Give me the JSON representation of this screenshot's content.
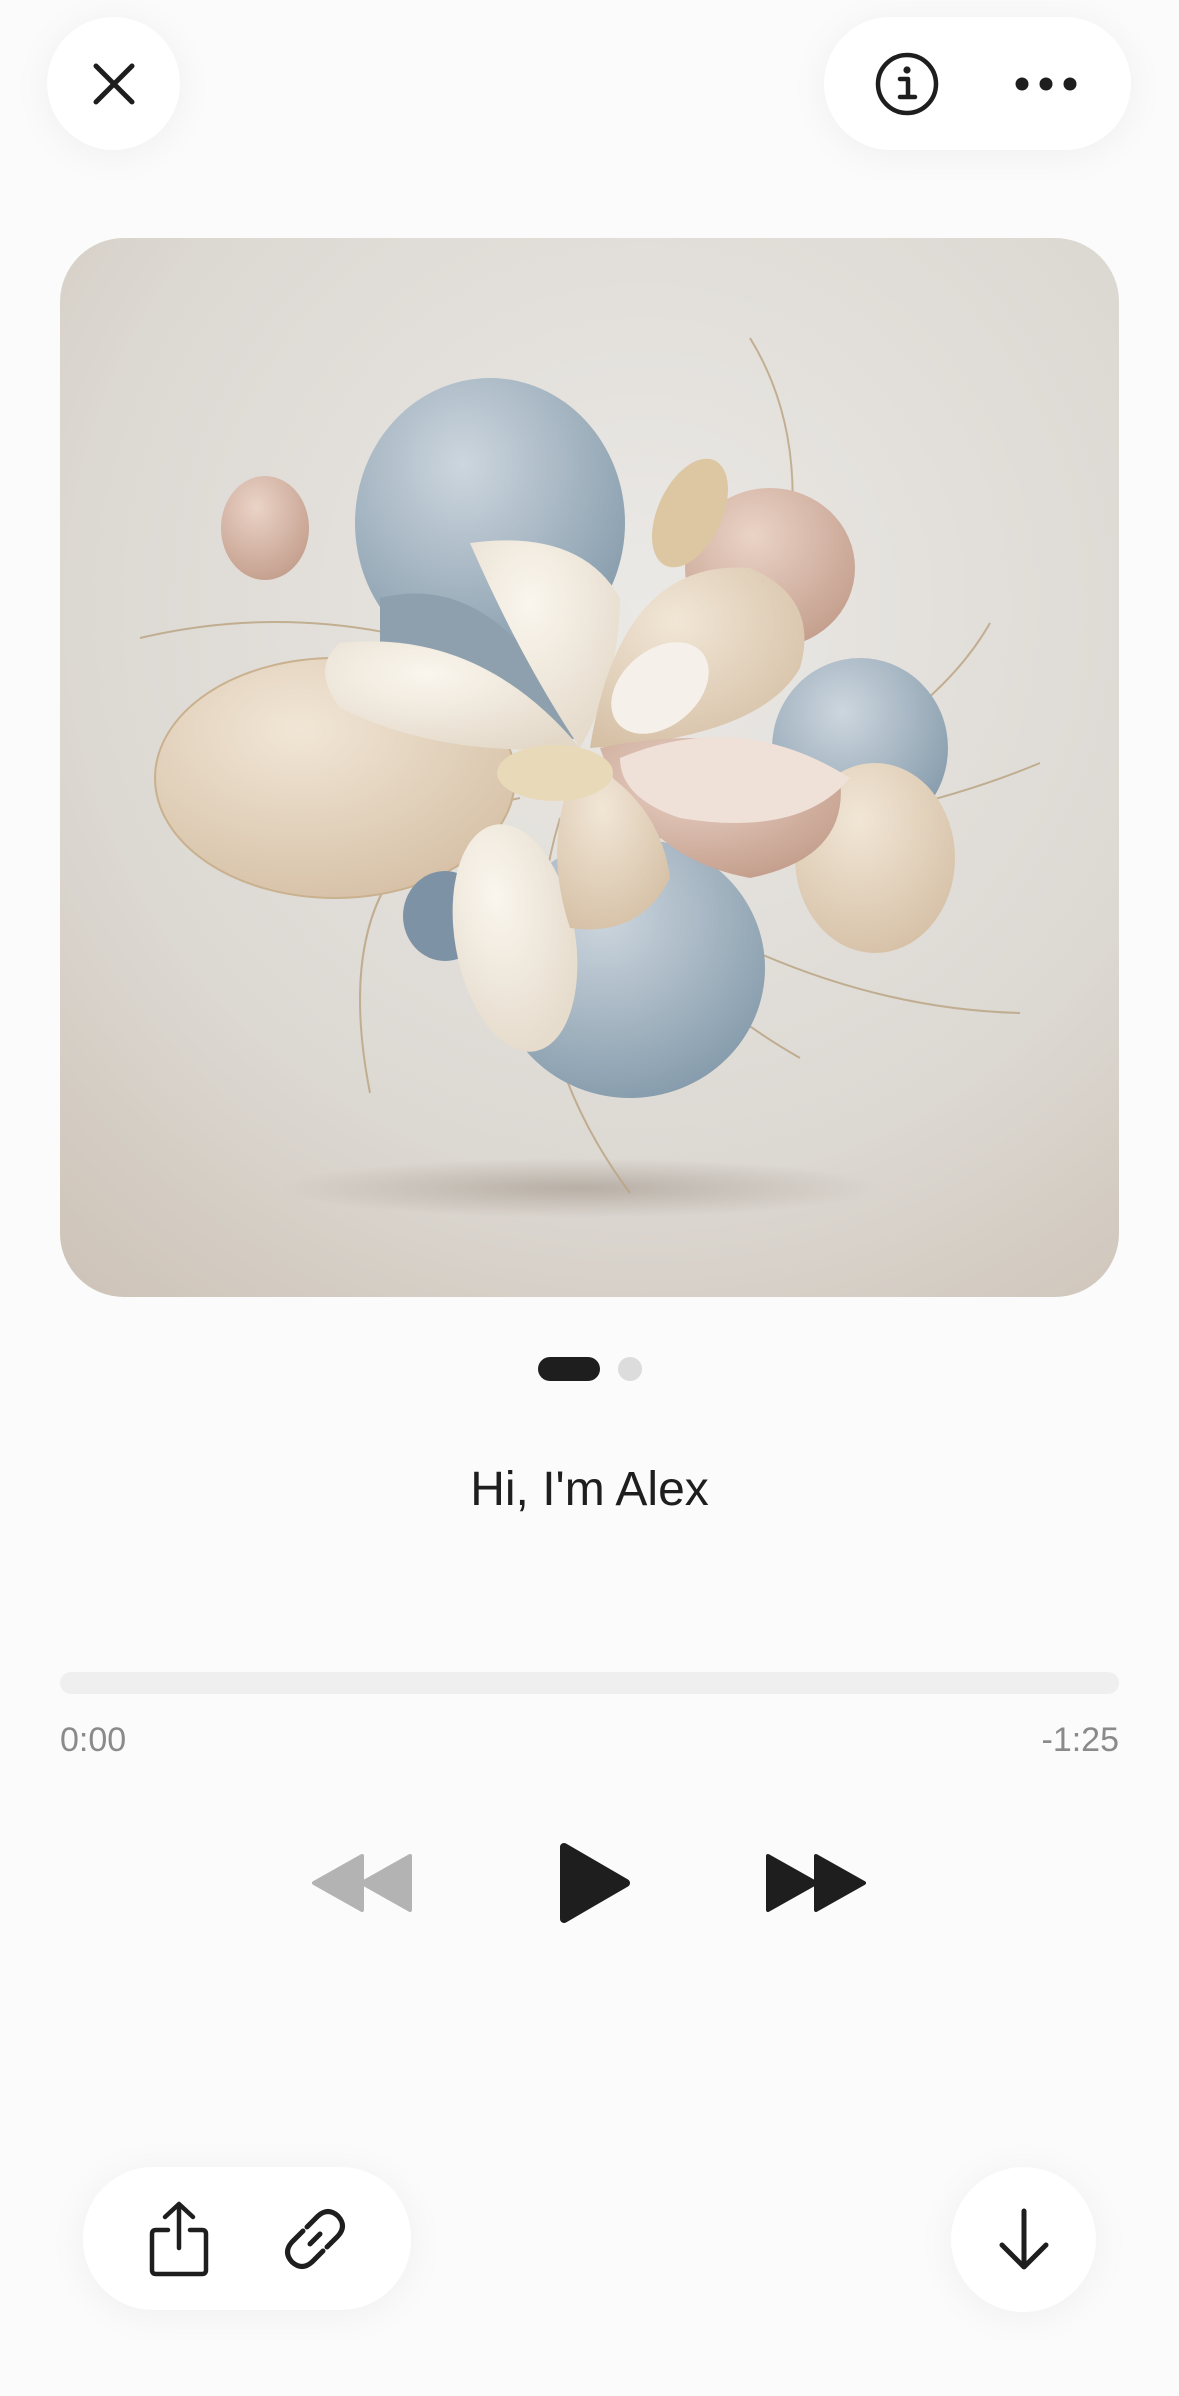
{
  "header": {
    "close_icon": "close-icon",
    "info_icon": "info-icon",
    "more_icon": "more-icon"
  },
  "artwork": {
    "description_icon": "abstract-floral-artwork",
    "background": "#dedad5"
  },
  "pager": {
    "total_pages": 2,
    "active_page": 1
  },
  "track": {
    "title": "Hi, I'm Alex"
  },
  "playback": {
    "elapsed": "0:00",
    "remaining": "-1:25",
    "progress_fraction": 0
  },
  "controls": {
    "rewind_icon": "rewind-icon",
    "play_icon": "play-icon",
    "forward_icon": "fast-forward-icon"
  },
  "bottom": {
    "share_icon": "share-icon",
    "link_icon": "link-icon",
    "download_icon": "download-icon"
  },
  "colors": {
    "primary": "#1e1e1e",
    "disabled": "#b3b3b3",
    "track_bg": "#efefef",
    "muted_text": "#8a8a8a"
  }
}
